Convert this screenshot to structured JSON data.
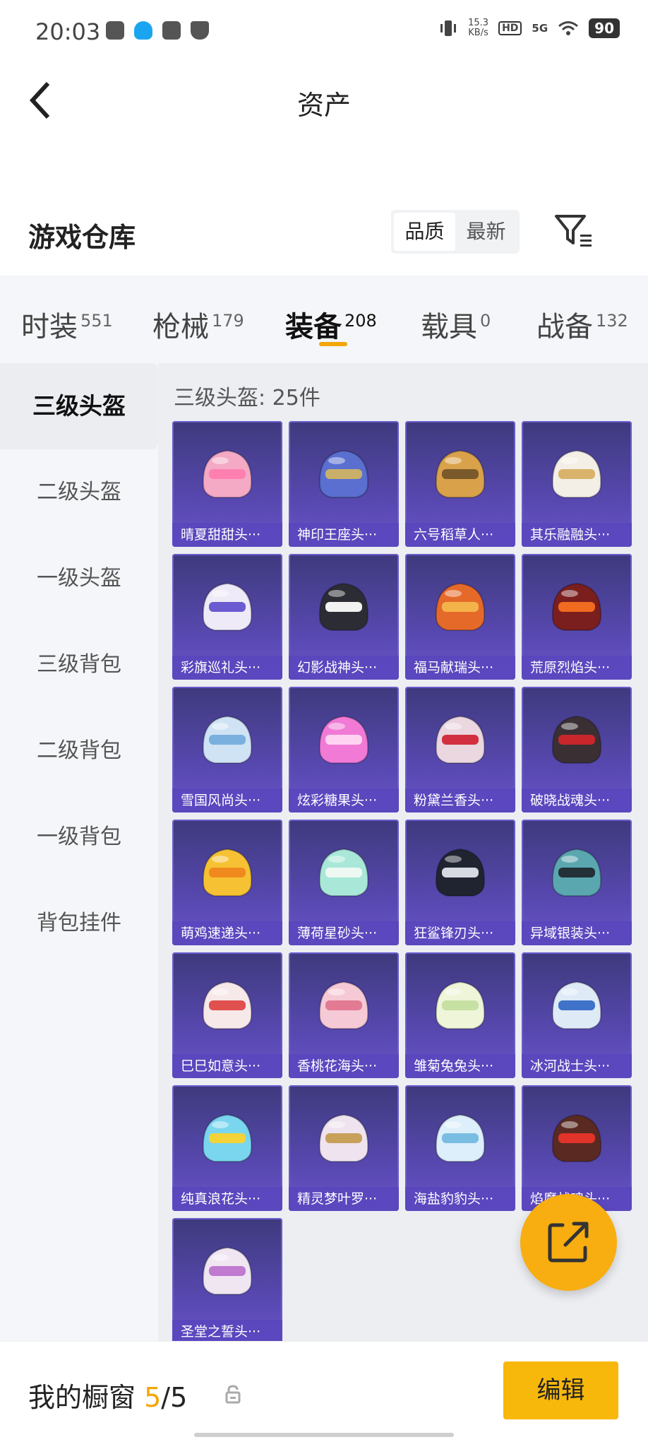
{
  "status": {
    "time": "20:03",
    "speed_value": "15.3",
    "speed_unit": "KB/s",
    "hd": "HD",
    "net": "5G",
    "battery": "90"
  },
  "header": {
    "title": "资产"
  },
  "warehouse": {
    "title": "游戏仓库",
    "sort_options": [
      "品质",
      "最新"
    ]
  },
  "tabs": [
    {
      "label": "时装",
      "count": "551"
    },
    {
      "label": "枪械",
      "count": "179"
    },
    {
      "label": "装备",
      "count": "208"
    },
    {
      "label": "载具",
      "count": "0"
    },
    {
      "label": "战备",
      "count": "132"
    }
  ],
  "sidebar": {
    "items": [
      "三级头盔",
      "二级头盔",
      "一级头盔",
      "三级背包",
      "二级背包",
      "一级背包",
      "背包挂件"
    ]
  },
  "content": {
    "count_label": "三级头盔: 25件",
    "items": [
      {
        "name": "晴夏甜甜头···",
        "color": "#f4a9c4",
        "accent": "#ff7fb0"
      },
      {
        "name": "神印王座头···",
        "color": "#5a6fd0",
        "accent": "#c9b06a"
      },
      {
        "name": "六号稻草人···",
        "color": "#d9a24a",
        "accent": "#7a5a2b"
      },
      {
        "name": "其乐融融头···",
        "color": "#f3efe6",
        "accent": "#d9b36b"
      },
      {
        "name": "彩旗巡礼头···",
        "color": "#efeaf7",
        "accent": "#6b5bd0"
      },
      {
        "name": "幻影战神头···",
        "color": "#2c2c34",
        "accent": "#f2f2f2"
      },
      {
        "name": "福马献瑞头···",
        "color": "#e56a2a",
        "accent": "#f4b34a"
      },
      {
        "name": "荒原烈焰头···",
        "color": "#7a1e1e",
        "accent": "#f06a20"
      },
      {
        "name": "雪国风尚头···",
        "color": "#cfe3f4",
        "accent": "#7ab0de"
      },
      {
        "name": "炫彩糖果头···",
        "color": "#f07ad6",
        "accent": "#ffd2f2"
      },
      {
        "name": "粉黛兰香头···",
        "color": "#ead7df",
        "accent": "#d23040"
      },
      {
        "name": "破晓战魂头···",
        "color": "#3a3034",
        "accent": "#c9262c"
      },
      {
        "name": "萌鸡速递头···",
        "color": "#f6c233",
        "accent": "#f08a1f"
      },
      {
        "name": "薄荷星砂头···",
        "color": "#a9e8d8",
        "accent": "#eef8f2"
      },
      {
        "name": "狂鲨锋刃头···",
        "color": "#1f2430",
        "accent": "#d7d9e0"
      },
      {
        "name": "异域银装头···",
        "color": "#5aa7b0",
        "accent": "#233038"
      },
      {
        "name": "巳巳如意头···",
        "color": "#f7e9e9",
        "accent": "#e0504f"
      },
      {
        "name": "香桃花海头···",
        "color": "#f6c9d6",
        "accent": "#e27a93"
      },
      {
        "name": "雏菊兔兔头···",
        "color": "#eef5d8",
        "accent": "#c7e0a3"
      },
      {
        "name": "冰河战士头···",
        "color": "#dfeaf7",
        "accent": "#3f73c9"
      },
      {
        "name": "纯真浪花头···",
        "color": "#7ad6ef",
        "accent": "#f4d23a"
      },
      {
        "name": "精灵梦叶罗···",
        "color": "#efe3ef",
        "accent": "#c7a05a"
      },
      {
        "name": "海盐豹豹头···",
        "color": "#dceffa",
        "accent": "#7abde3"
      },
      {
        "name": "焰魔战魂头···",
        "color": "#5a2a22",
        "accent": "#e0332a"
      },
      {
        "name": "圣堂之誓头···",
        "color": "#efe6f2",
        "accent": "#c07ad0"
      }
    ]
  },
  "bottom": {
    "label": "我的橱窗",
    "used": "5",
    "separator": "/",
    "total": "5",
    "edit_label": "编辑"
  },
  "colors": {
    "accent": "#f3a60b",
    "card_bg": "#4b3f9b",
    "edit_button": "#f7b80b"
  }
}
